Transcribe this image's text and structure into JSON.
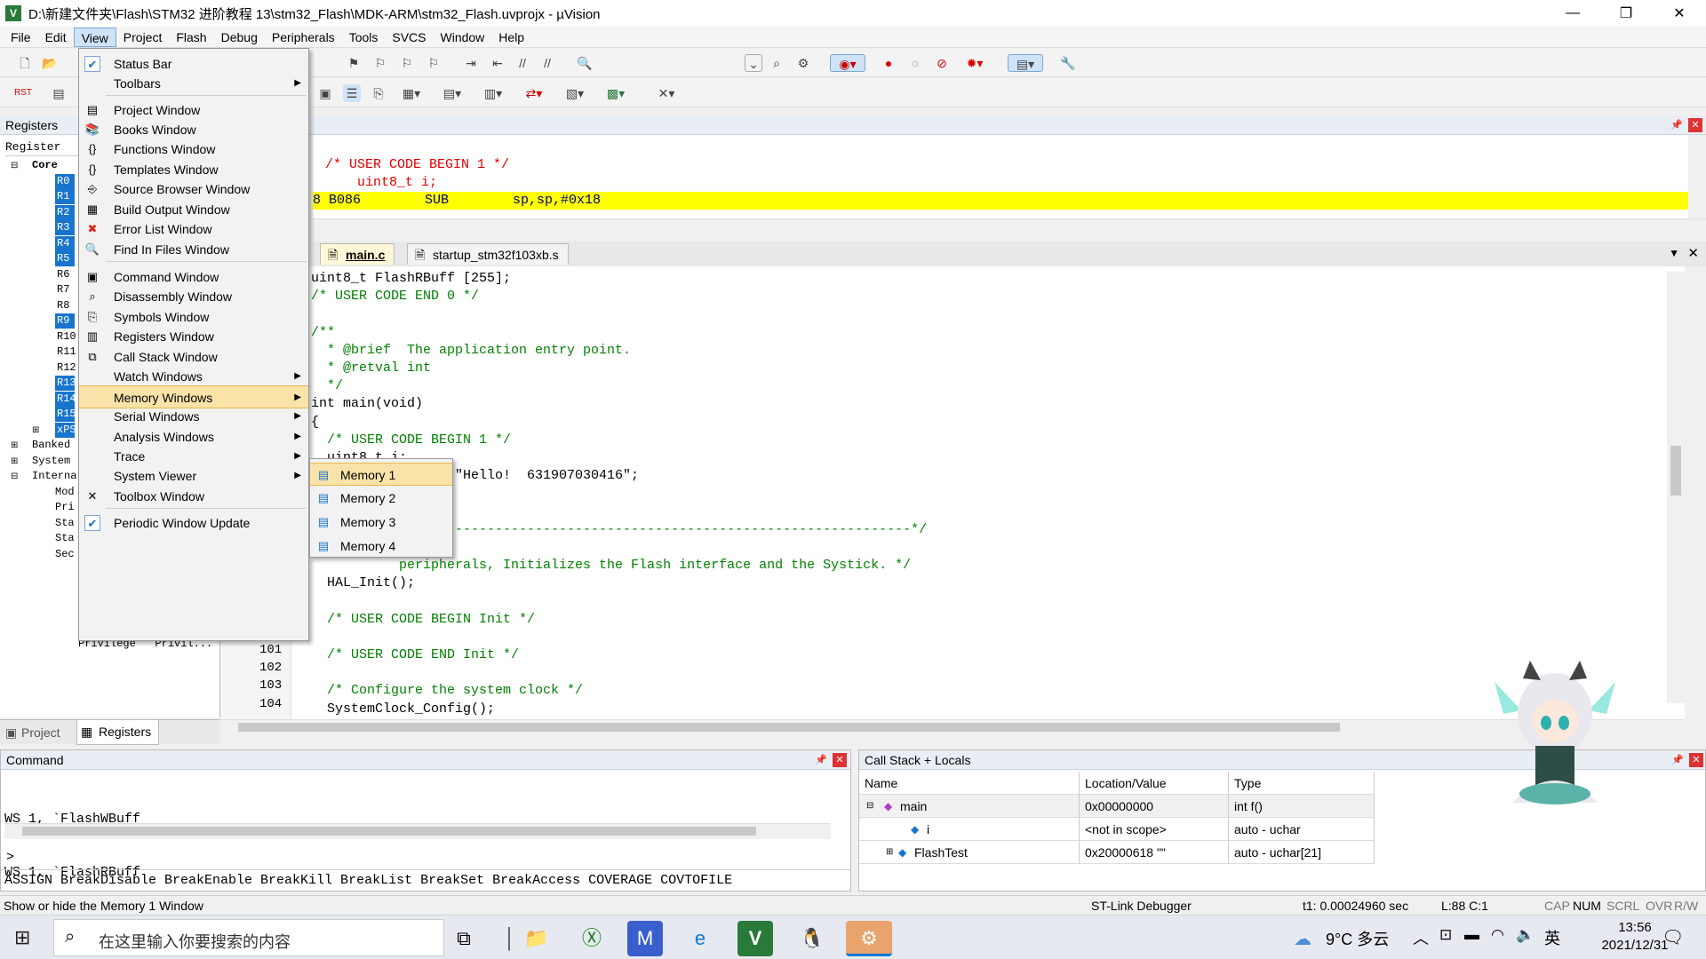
{
  "window": {
    "title": "D:\\新建文件夹\\Flash\\STM32 进阶教程 13\\stm32_Flash\\MDK-ARM\\stm32_Flash.uvprojx - µVision",
    "minimize": "—",
    "restore": "❐",
    "close": "✕"
  },
  "menubar": [
    "File",
    "Edit",
    "View",
    "Project",
    "Flash",
    "Debug",
    "Peripherals",
    "Tools",
    "SVCS",
    "Window",
    "Help"
  ],
  "view_menu": {
    "items": [
      {
        "label": "Status Bar",
        "icon": "check-icon",
        "checked": true
      },
      {
        "label": "Toolbars",
        "submenu": true
      },
      {
        "label": "Project Window",
        "icon": "project-window-icon"
      },
      {
        "label": "Books Window",
        "icon": "books-icon"
      },
      {
        "label": "Functions Window",
        "icon": "functions-icon"
      },
      {
        "label": "Templates Window",
        "icon": "templates-icon"
      },
      {
        "label": "Source Browser Window",
        "icon": "source-browser-icon"
      },
      {
        "label": "Build Output Window",
        "icon": "build-output-icon"
      },
      {
        "label": "Error List Window",
        "icon": "error-list-icon"
      },
      {
        "label": "Find In Files Window",
        "icon": "find-in-files-icon"
      },
      {
        "label": "Command Window",
        "icon": "command-window-icon"
      },
      {
        "label": "Disassembly Window",
        "icon": "disassembly-icon"
      },
      {
        "label": "Symbols Window",
        "icon": "symbols-icon"
      },
      {
        "label": "Registers Window",
        "icon": "registers-icon"
      },
      {
        "label": "Call Stack Window",
        "icon": "call-stack-icon"
      },
      {
        "label": "Watch Windows",
        "submenu": true
      },
      {
        "label": "Memory Windows",
        "submenu": true,
        "highlighted": true
      },
      {
        "label": "Serial Windows",
        "submenu": true
      },
      {
        "label": "Analysis Windows",
        "submenu": true
      },
      {
        "label": "Trace",
        "submenu": true
      },
      {
        "label": "System Viewer",
        "submenu": true
      },
      {
        "label": "Toolbox Window",
        "icon": "toolbox-icon"
      },
      {
        "label": "Periodic Window Update",
        "icon": "check-icon",
        "checked": true
      }
    ]
  },
  "memory_submenu": [
    "Memory 1",
    "Memory 2",
    "Memory 3",
    "Memory 4"
  ],
  "registers_panel": {
    "title": "Registers",
    "column_header": "Register",
    "core_label": "Core",
    "registers": [
      "R0",
      "R1",
      "R2",
      "R3",
      "R4",
      "R5",
      "R6",
      "R7",
      "R8",
      "R9",
      "R10",
      "R11",
      "R12",
      "R13",
      "R14",
      "R15",
      "xPS"
    ],
    "selected": [
      "R0",
      "R1",
      "R2",
      "R3",
      "R4",
      "R5",
      "R9",
      "R13",
      "R14",
      "R15",
      "xPS"
    ],
    "groups": [
      "Banked",
      "System",
      "Interna"
    ],
    "internal_items": [
      "Mod",
      "Pri",
      "Sta",
      "Sta",
      "Sec"
    ],
    "bottom_row": "Privilege   Privil...",
    "tabs": [
      "Project",
      "Registers"
    ]
  },
  "disassembly": {
    "lines": [
      "/* USER CODE BEGIN 1 */",
      "    uint8_t i;",
      "8 B086        SUB        sp,sp,#0x18"
    ]
  },
  "editor": {
    "tabs": [
      "main.c",
      "startup_stm32f103xb.s"
    ],
    "lines": [
      "uint8_t FlashRBuff [255];",
      "/* USER CODE END 0 */",
      "",
      "/**",
      "  * @brief  The application entry point.",
      "  * @retval int",
      "  */",
      "int main(void)",
      "{",
      "  /* USER CODE BEGIN 1 */",
      "  uint8_t i;",
      "           st[] = \"Hello!  631907030416\";",
      "           D 1 */",
      "",
      "           ation-----------------------------------------------------------*/",
      "",
      "           peripherals, Initializes the Flash interface and the Systick. */",
      "  HAL_Init();",
      "",
      "  /* USER CODE BEGIN Init */",
      "",
      "  /* USER CODE END Init */",
      "",
      "  /* Configure the system clock */",
      "  SystemClock_Config();"
    ],
    "line_numbers": [
      "101",
      "102",
      "103",
      "104"
    ]
  },
  "command_panel": {
    "title": "Command",
    "lines": [
      "WS 1, `FlashWBuff",
      "WS 1, `FlashRBuff"
    ],
    "prompt": ">",
    "hints": "ASSIGN BreakDisable BreakEnable BreakKill BreakList BreakSet BreakAccess COVERAGE COVTOFILE"
  },
  "callstack_panel": {
    "title": "Call Stack + Locals",
    "columns": [
      "Name",
      "Location/Value",
      "Type"
    ],
    "rows": [
      {
        "name": "main",
        "value": "0x00000000",
        "type": "int f()"
      },
      {
        "name": "i",
        "value": "<not in scope>",
        "type": "auto - uchar"
      },
      {
        "name": "FlashTest",
        "value": "0x20000618 \"\"",
        "type": "auto - uchar[21]"
      }
    ]
  },
  "statusbar": {
    "message": "Show or hide the Memory 1 Window",
    "debugger": "ST-Link Debugger",
    "time": "t1: 0.00024960 sec",
    "position": "L:88 C:1",
    "indicators": [
      "CAP",
      "NUM",
      "SCRL",
      "OVR",
      "R/W"
    ]
  },
  "taskbar": {
    "search_placeholder": "在这里输入你要搜索的内容",
    "weather": "9°C 多云",
    "ime": "英",
    "clock_time": "13:56",
    "clock_date": "2021/12/31"
  },
  "colors": {
    "accent": "#1874cd",
    "highlight_line": "#ffff00",
    "menu_highlight": "#fae3a8",
    "comment": "#008000",
    "keyword": "#0000ff",
    "string": "#a31515",
    "disasm_comment": "#ff0000"
  }
}
